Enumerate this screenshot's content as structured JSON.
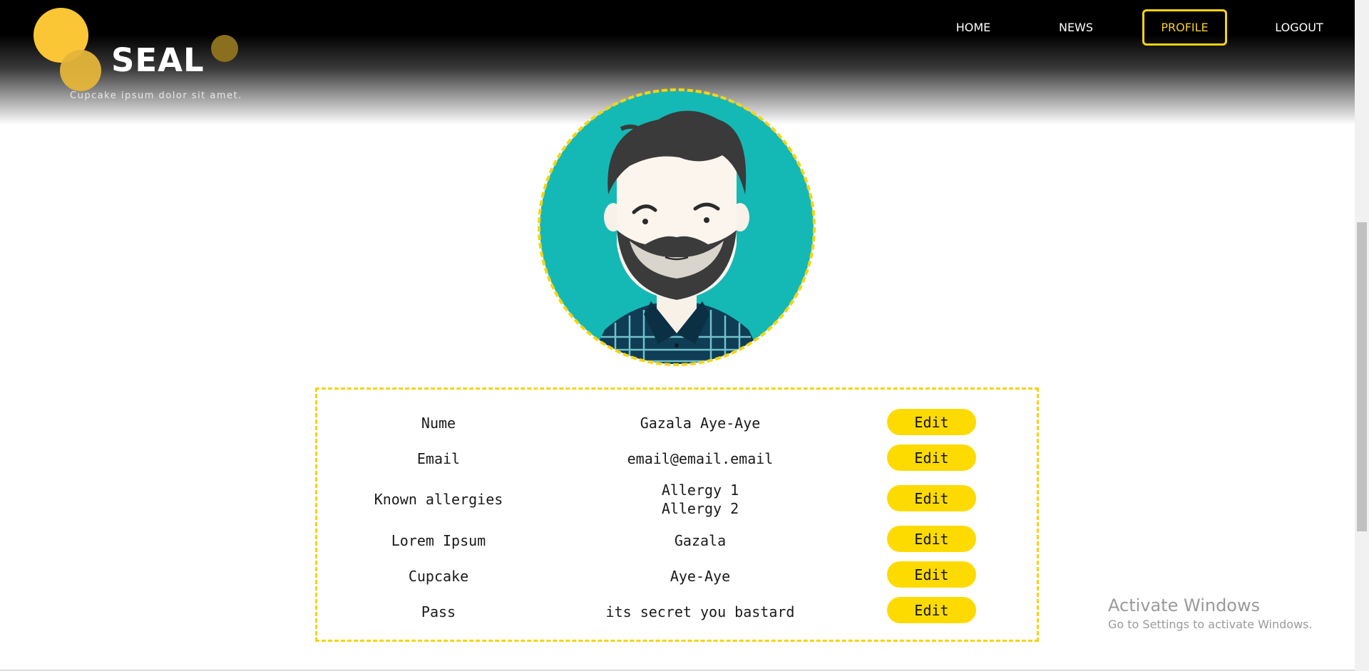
{
  "brand": {
    "name": "SEAL",
    "tagline": "Cupcake ipsum dolor sit amet.",
    "colors": {
      "accent": "#fddb00",
      "logo_primary": "#fbc636",
      "logo_secondary": "#e5b43a",
      "logo_dark": "#8a6f1e"
    }
  },
  "nav": {
    "home": "HOME",
    "news": "NEWS",
    "profile": "PROFILE",
    "logout": "LOGOUT",
    "active": "PROFILE"
  },
  "avatar": {
    "icon": "user-avatar-illustration",
    "background": "#14b9b5",
    "border": "#f5d40f"
  },
  "profile": {
    "rows": [
      {
        "label": "Nume",
        "value_lines": [
          "Gazala Aye-Aye"
        ],
        "action": "Edit"
      },
      {
        "label": "Email",
        "value_lines": [
          "email@email.email"
        ],
        "action": "Edit"
      },
      {
        "label": "Known allergies",
        "value_lines": [
          "Allergy 1",
          "Allergy 2"
        ],
        "action": "Edit"
      },
      {
        "label": "Lorem Ipsum",
        "value_lines": [
          "Gazala"
        ],
        "action": "Edit"
      },
      {
        "label": "Cupcake",
        "value_lines": [
          "Aye-Aye"
        ],
        "action": "Edit"
      },
      {
        "label": "Pass",
        "value_lines": [
          "its secret you bastard"
        ],
        "action": "Edit"
      }
    ]
  },
  "watermark": {
    "line1": "Activate Windows",
    "line2": "Go to Settings to activate Windows."
  }
}
